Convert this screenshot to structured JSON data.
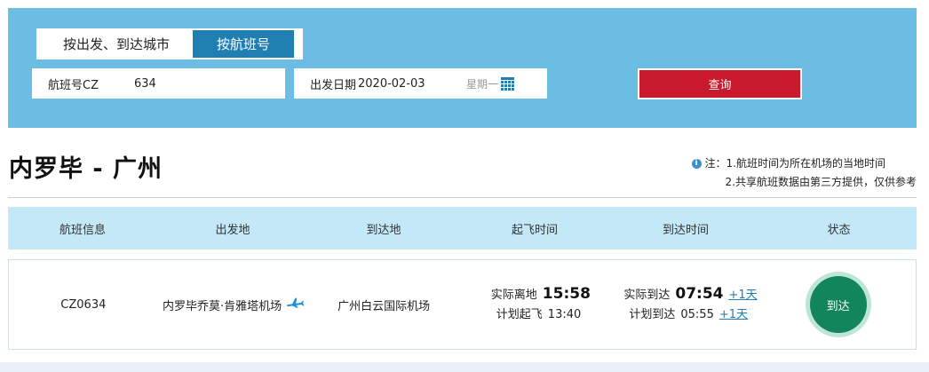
{
  "search": {
    "tabs": {
      "by_city": "按出发、到达城市",
      "by_flight": "按航班号"
    },
    "flight_no_label": "航班号CZ",
    "flight_no_value": "634",
    "date_label": "出发日期",
    "date_value": "2020-02-03",
    "weekday": "星期一",
    "button_label": "查询"
  },
  "route": {
    "title": "内罗毕 - 广州"
  },
  "notes": {
    "line1": "注：1.航班时间为所在机场的当地时间",
    "line2": "2.共享航班数据由第三方提供，仅供参考"
  },
  "table": {
    "headers": [
      "航班信息",
      "出发地",
      "到达地",
      "起飞时间",
      "到达时间",
      "状态"
    ],
    "row": {
      "flight": "CZ0634",
      "origin": "内罗毕乔莫·肯雅塔机场",
      "destination": "广州白云国际机场",
      "actual_dep_label": "实际离地",
      "actual_dep_time": "15:58",
      "planned_dep_label": "计划起飞",
      "planned_dep_time": "13:40",
      "actual_arr_label": "实际到达",
      "actual_arr_time": "07:54",
      "actual_arr_plus": "+1天",
      "planned_arr_label": "计划到达",
      "planned_arr_time": "05:55",
      "planned_arr_plus": "+1天",
      "status": "到达"
    }
  },
  "icons": {
    "calendar": "calendar-icon",
    "info": "info-icon",
    "plane": "plane-icon"
  },
  "colors": {
    "panel": "#6bbde3",
    "active_tab": "#1f7fb3",
    "search_button": "#c8192d",
    "status": "#13855b",
    "header_row": "#c3e8f7"
  }
}
